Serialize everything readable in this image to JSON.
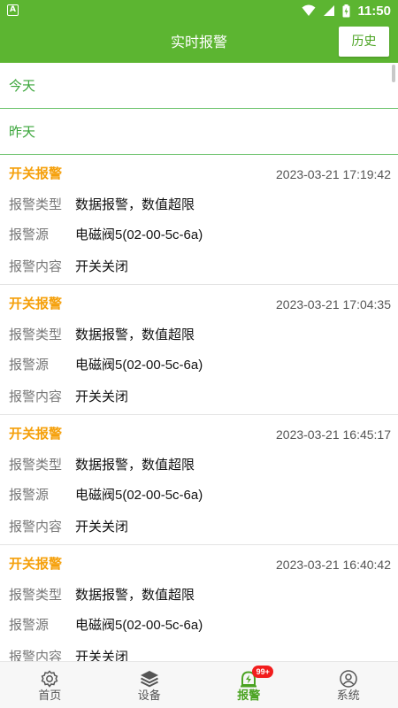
{
  "status_bar": {
    "time": "11:50",
    "left_icon": "A"
  },
  "header": {
    "title": "实时报警",
    "history_label": "历史"
  },
  "days": [
    {
      "label": "今天"
    },
    {
      "label": "昨天"
    }
  ],
  "alarms": [
    {
      "type": "开关报警",
      "time": "2023-03-21 17:19:42",
      "fields": [
        {
          "label": "报警类型",
          "value": "数据报警，数值超限"
        },
        {
          "label": "报警源",
          "value": "电磁阀5(02-00-5c-6a)"
        },
        {
          "label": "报警内容",
          "value": "开关关闭"
        }
      ]
    },
    {
      "type": "开关报警",
      "time": "2023-03-21 17:04:35",
      "fields": [
        {
          "label": "报警类型",
          "value": "数据报警，数值超限"
        },
        {
          "label": "报警源",
          "value": "电磁阀5(02-00-5c-6a)"
        },
        {
          "label": "报警内容",
          "value": "开关关闭"
        }
      ]
    },
    {
      "type": "开关报警",
      "time": "2023-03-21 16:45:17",
      "fields": [
        {
          "label": "报警类型",
          "value": "数据报警，数值超限"
        },
        {
          "label": "报警源",
          "value": "电磁阀5(02-00-5c-6a)"
        },
        {
          "label": "报警内容",
          "value": "开关关闭"
        }
      ]
    },
    {
      "type": "开关报警",
      "time": "2023-03-21 16:40:42",
      "fields": [
        {
          "label": "报警类型",
          "value": "数据报警，数值超限"
        },
        {
          "label": "报警源",
          "value": "电磁阀5(02-00-5c-6a)"
        },
        {
          "label": "报警内容",
          "value": "开关关闭"
        }
      ]
    }
  ],
  "bottom_nav": {
    "items": [
      {
        "label": "首页",
        "icon": "gear-icon"
      },
      {
        "label": "设备",
        "icon": "layers-icon"
      },
      {
        "label": "报警",
        "icon": "alarm-icon",
        "badge": "99+"
      },
      {
        "label": "系统",
        "icon": "user-circle-icon"
      }
    ],
    "active_index": 2
  },
  "colors": {
    "primary": "#5cb531",
    "alarm_type": "#f5a00b",
    "day_label": "#3aa53a",
    "badge": "#f21d1d"
  }
}
